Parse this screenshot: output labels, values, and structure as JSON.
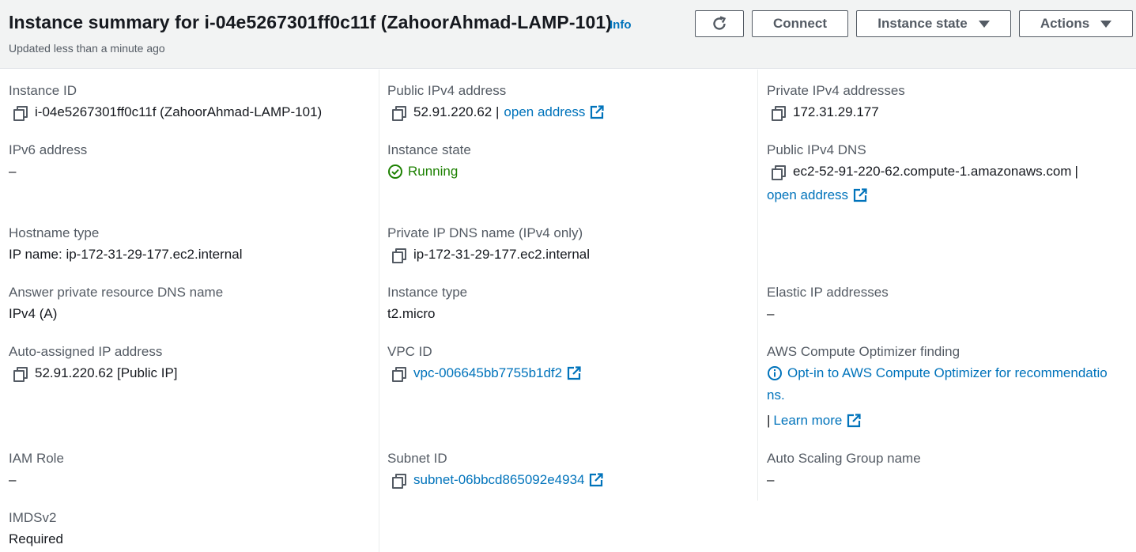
{
  "header": {
    "title": "Instance summary for i-04e5267301ff0c11f (ZahoorAhmad-LAMP-101)",
    "info": "Info",
    "updated": "Updated less than a minute ago",
    "connect": "Connect",
    "instance_state": "Instance state",
    "actions": "Actions"
  },
  "fields": {
    "instance_id": {
      "label": "Instance ID",
      "value": "i-04e5267301ff0c11f (ZahoorAhmad-LAMP-101)"
    },
    "public_ipv4": {
      "label": "Public IPv4 address",
      "value": "52.91.220.62 |",
      "link": "open address"
    },
    "private_ipv4": {
      "label": "Private IPv4 addresses",
      "value": "172.31.29.177"
    },
    "ipv6": {
      "label": "IPv6 address",
      "value": "–"
    },
    "instance_state": {
      "label": "Instance state",
      "value": "Running"
    },
    "public_dns": {
      "label": "Public IPv4 DNS",
      "value": "ec2-52-91-220-62.compute-1.amazonaws.com",
      "sep": "|",
      "link": "open address"
    },
    "hostname_type": {
      "label": "Hostname type",
      "value": "IP name: ip-172-31-29-177.ec2.internal"
    },
    "private_dns": {
      "label": "Private IP DNS name (IPv4 only)",
      "value": "ip-172-31-29-177.ec2.internal"
    },
    "answer_dns": {
      "label": "Answer private resource DNS name",
      "value": "IPv4 (A)"
    },
    "instance_type": {
      "label": "Instance type",
      "value": "t2.micro"
    },
    "elastic_ip": {
      "label": "Elastic IP addresses",
      "value": "–"
    },
    "auto_ip": {
      "label": "Auto-assigned IP address",
      "value": "52.91.220.62 [Public IP]"
    },
    "vpc_id": {
      "label": "VPC ID",
      "value": "vpc-006645bb7755b1df2"
    },
    "optimizer": {
      "label": "AWS Compute Optimizer finding",
      "line1": "Opt-in to AWS Compute Optimizer for recommendatio",
      "line2": "ns.",
      "sep": "|",
      "learn": "Learn more"
    },
    "iam_role": {
      "label": "IAM Role",
      "value": "–"
    },
    "subnet_id": {
      "label": "Subnet ID",
      "value": "subnet-06bbcd865092e4934"
    },
    "asg_name": {
      "label": "Auto Scaling Group name",
      "value": "–"
    },
    "imdsv2": {
      "label": "IMDSv2",
      "value": "Required"
    }
  },
  "colors": {
    "link": "#0073bb",
    "running": "#1d8102",
    "header_bg": "#f2f3f3"
  }
}
